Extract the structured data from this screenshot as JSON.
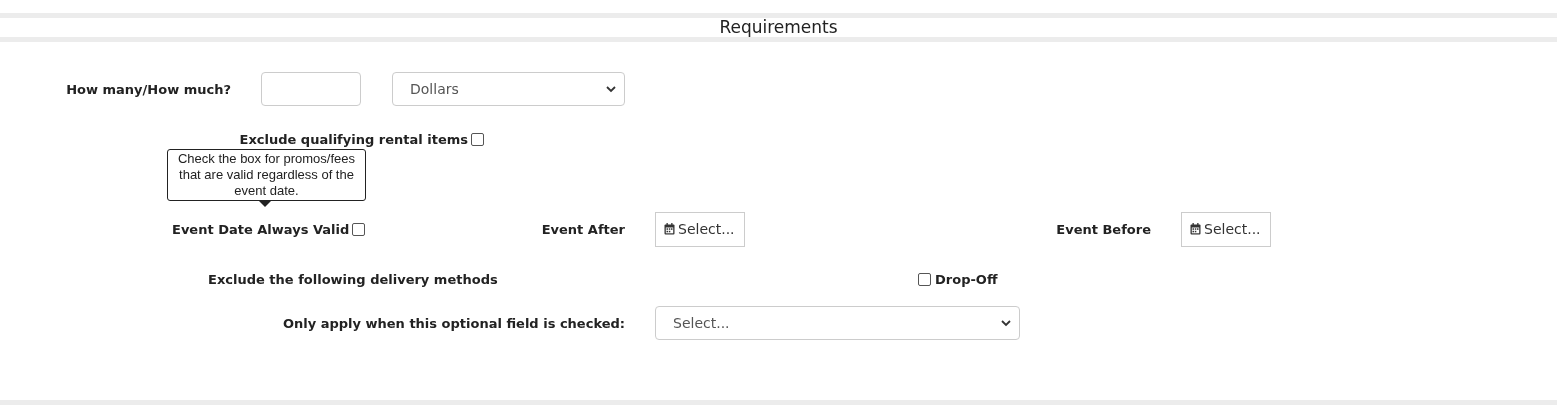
{
  "section_title": "Requirements",
  "amount": {
    "label": "How many/How much?",
    "unit": "Dollars"
  },
  "exclude_rental": {
    "label": "Exclude qualifying rental items",
    "checked": false
  },
  "tooltip": "Check the box for promos/fees that are valid regardless of the event date.",
  "event_date": {
    "label": "Event Date Always Valid",
    "checked": false
  },
  "event_after": {
    "label": "Event After",
    "button": "Select..."
  },
  "event_before": {
    "label": "Event Before",
    "button": "Select..."
  },
  "delivery": {
    "label": "Exclude the following delivery methods",
    "methods": [
      {
        "label": "Drop-Off",
        "checked": false
      }
    ]
  },
  "optional_field": {
    "label": "Only apply when this optional field is checked:",
    "value": "Select..."
  }
}
